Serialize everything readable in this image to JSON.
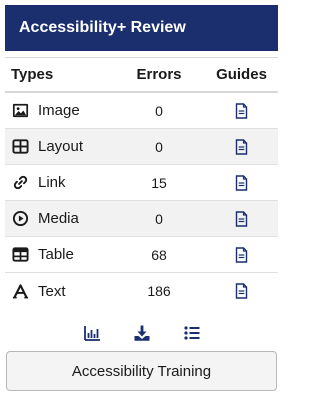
{
  "header": {
    "title": "Accessibility+ Review"
  },
  "table": {
    "columns": {
      "types": "Types",
      "errors": "Errors",
      "guides": "Guides"
    },
    "rows": [
      {
        "label": "Image",
        "errors": "0",
        "icon": "image-icon"
      },
      {
        "label": "Layout",
        "errors": "0",
        "icon": "layout-icon"
      },
      {
        "label": "Link",
        "errors": "15",
        "icon": "link-icon"
      },
      {
        "label": "Media",
        "errors": "0",
        "icon": "media-play-icon"
      },
      {
        "label": "Table",
        "errors": "68",
        "icon": "table-icon"
      },
      {
        "label": "Text",
        "errors": "186",
        "icon": "text-icon"
      }
    ],
    "guide_icon": "document-icon"
  },
  "toolbar": {
    "icons": [
      "bar-chart-icon",
      "download-icon",
      "list-icon"
    ]
  },
  "training_button": {
    "label": "Accessibility Training"
  },
  "colors": {
    "header_bg": "#1b2f6e",
    "accent": "#1b2f6e",
    "row_alt": "#f2f2f2"
  }
}
